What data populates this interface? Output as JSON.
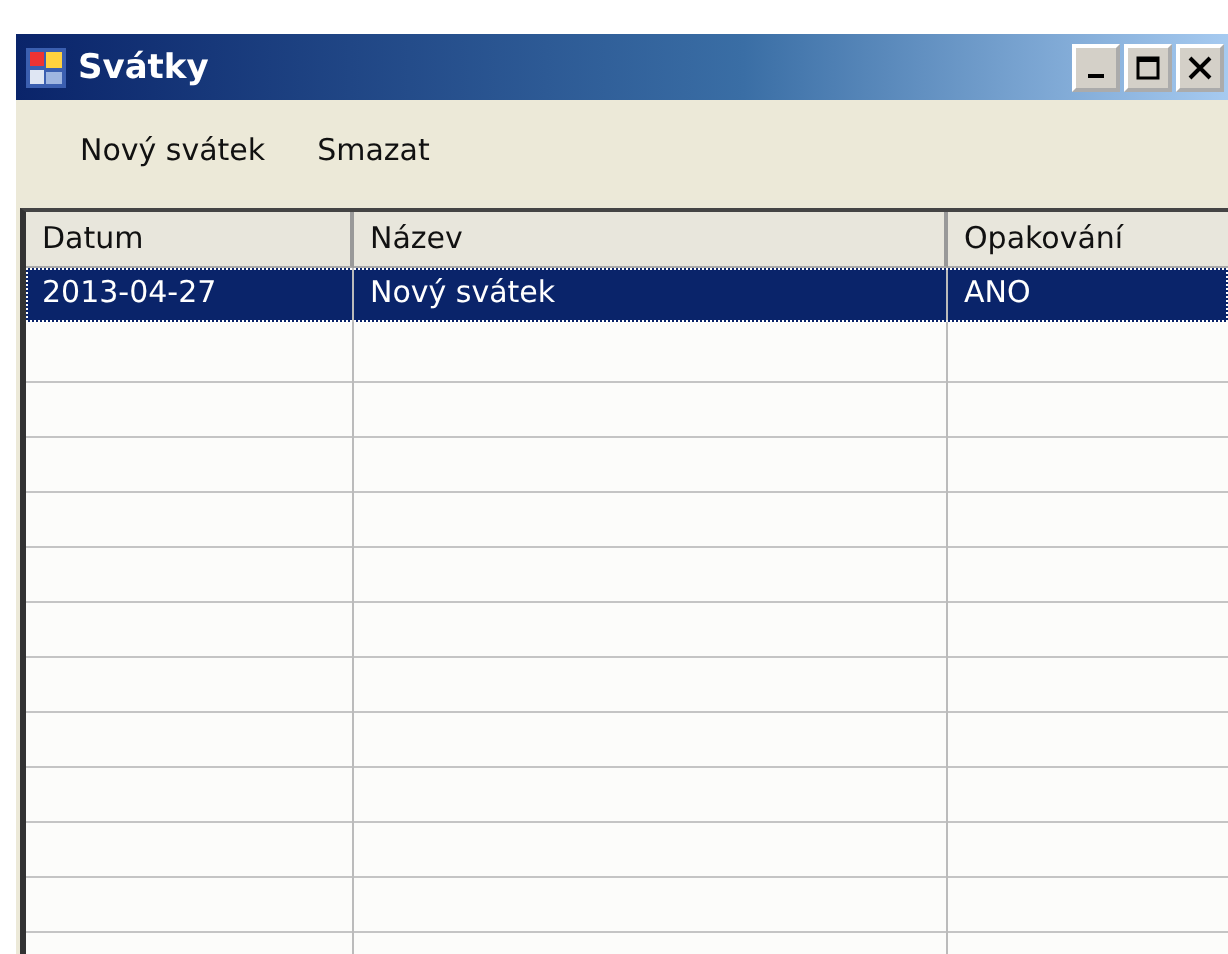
{
  "window": {
    "title": "Svátky"
  },
  "toolbar": [
    "Nový svátek",
    "Smazat"
  ],
  "table": {
    "columns": [
      "Datum",
      "Název",
      "Opakování"
    ],
    "rows": [
      {
        "cells": [
          "2013-04-27",
          "Nový svátek",
          "ANO"
        ],
        "selected": true
      }
    ]
  }
}
